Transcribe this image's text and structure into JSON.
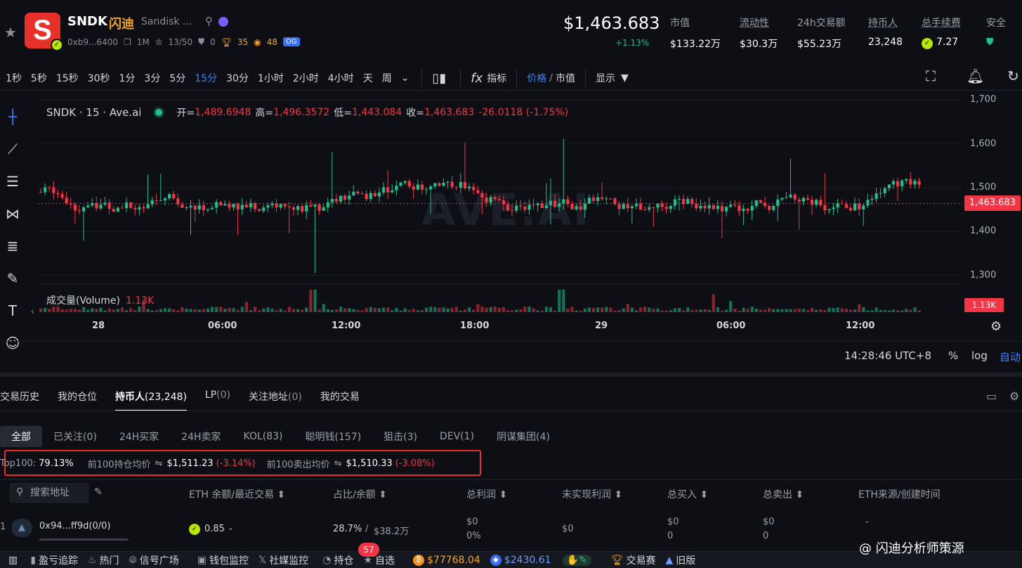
{
  "token": {
    "symbol": "SNDK",
    "cn_name": "闪迪",
    "name": "Sandisk ...",
    "address": "0xb9...6400",
    "age": "1M",
    "holders_rank": "13/50",
    "stat_a": "0",
    "trophy": "35",
    "coins": "48",
    "og": "OG"
  },
  "header": {
    "price": "$1,463.683",
    "change": "+1.13%",
    "stats": [
      {
        "label": "市值",
        "value": "$133.22万"
      },
      {
        "label": "流动性",
        "value": "$30.3万"
      },
      {
        "label": "24h交易额",
        "value": "$55.23万"
      },
      {
        "label": "持币人",
        "value": "23,248"
      },
      {
        "label": "总手续费",
        "value": "7.27"
      },
      {
        "label": "安全"
      }
    ]
  },
  "toolbar": {
    "timeframes": [
      "1秒",
      "5秒",
      "15秒",
      "30秒",
      "1分",
      "3分",
      "5分",
      "15分",
      "30分",
      "1小时",
      "2小时",
      "4小时",
      "天",
      "周"
    ],
    "active": "15分",
    "indicators": "指标",
    "price_label": "价格",
    "mcap_label": "市值",
    "display": "显示"
  },
  "chart": {
    "legend": {
      "title": "SNDK · 15 · Ave.ai",
      "open_k": "开=",
      "open_v": "1,489.6948",
      "high_k": "高=",
      "high_v": "1,496.3572",
      "low_k": "低=",
      "low_v": "1,443.084",
      "close_k": "收=",
      "close_v": "1,463.683",
      "change": "-26.0118 (-1.75%)"
    },
    "volume_label": "成交量(Volume)",
    "volume_value": "1.13K",
    "price_tag": "1,463.683",
    "volume_tag": "1.13K",
    "watermark": "AVE.AI",
    "time": "14:28:46 UTC+8",
    "percent": "%",
    "log": "log",
    "auto": "自动",
    "colors": {
      "up": "#1fbf8f",
      "down": "#f23645"
    }
  },
  "chart_data": {
    "type": "candlestick",
    "y_ticks": [
      1700,
      1600,
      1500,
      1400,
      1300
    ],
    "x_ticks": [
      "28",
      "06:00",
      "12:00",
      "18:00",
      "29",
      "06:00",
      "12:00"
    ],
    "ylim": [
      1280,
      1720
    ],
    "last": 1463.683
  },
  "panel": {
    "tabs": [
      {
        "label": "交易历史",
        "count": ""
      },
      {
        "label": "我的仓位",
        "count": ""
      },
      {
        "label": "持币人",
        "count": "(23,248)"
      },
      {
        "label": "LP",
        "count": "(0)"
      },
      {
        "label": "关注地址",
        "count": "(0)"
      },
      {
        "label": "我的交易",
        "count": ""
      }
    ],
    "filters": [
      "全部",
      "已关注(0)",
      "24H买家",
      "24H卖家",
      "KOL(83)",
      "聪明钱(157)",
      "狙击(3)",
      "DEV(1)",
      "阴谋集团(4)"
    ],
    "top100": {
      "label": "Top100:",
      "pct": "79.13%",
      "hold_label": "前100持仓均价",
      "hold_price": "$1,511.23",
      "hold_chg": "(-3.14%)",
      "sell_label": "前100卖出均价",
      "sell_price": "$1,510.33",
      "sell_chg": "(-3.08%)"
    },
    "search_placeholder": "搜索地址",
    "columns": [
      "ETH 余额/最近交易",
      "占比/余额",
      "总利润",
      "未实现利润",
      "总买入",
      "总卖出",
      "ETH来源/创建时间"
    ],
    "row": {
      "rank": "1",
      "address": "0x94...ff9d(0/0)",
      "eth": "0.85",
      "eth_recent": "-",
      "share": "28.7%",
      "balance": "$38.2万",
      "profit": "$0",
      "profit_pct": "0%",
      "unrealized": "$0",
      "buy": "$0",
      "buy_n": "0",
      "sell": "$0",
      "sell_n": "0",
      "source": "-"
    }
  },
  "bottombar": {
    "items": [
      "盈亏追踪",
      "热门",
      "信号广场",
      "钱包监控",
      "社媒监控",
      "持仓",
      "自选"
    ],
    "badge": "57",
    "btc": "$77768.04",
    "eth": "$2430.61",
    "contest": "交易赛",
    "old": "旧版",
    "credit": "@ 闪迪分析师策源"
  }
}
